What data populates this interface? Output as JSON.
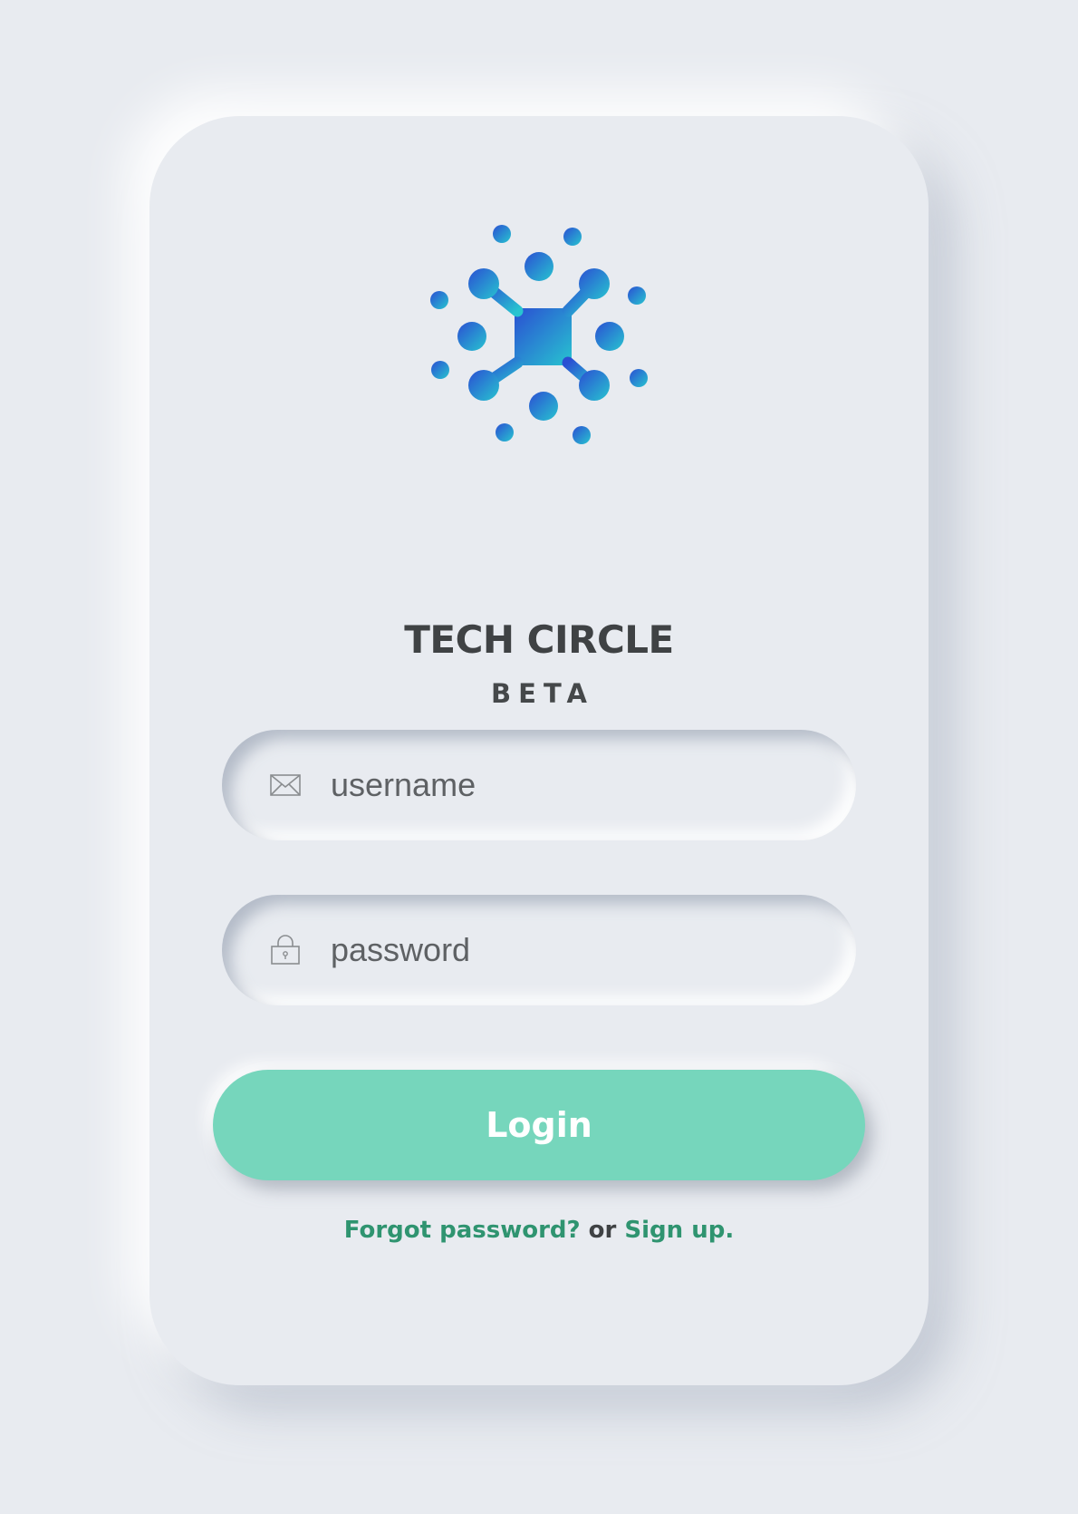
{
  "brand": {
    "name": "TECH CIRCLE",
    "tagline": "BETA",
    "logo_icon": "network-hub-icon",
    "logo_gradient": [
      "#2a4fd3",
      "#28c4d0"
    ]
  },
  "form": {
    "username": {
      "placeholder": "username",
      "value": "",
      "icon": "envelope-icon"
    },
    "password": {
      "placeholder": "password",
      "value": "",
      "icon": "padlock-icon"
    },
    "login_label": "Login"
  },
  "footer": {
    "forgot_label": "Forgot password?",
    "separator": " or ",
    "signup_label": "Sign up."
  },
  "colors": {
    "background": "#e8ebf0",
    "accent": "#76d6bc",
    "link": "#2f9470",
    "text": "#3f4244"
  }
}
